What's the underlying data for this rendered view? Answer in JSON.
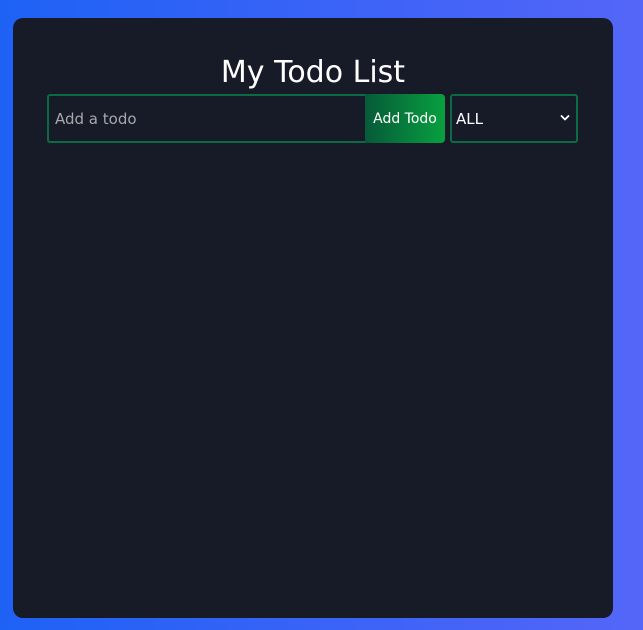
{
  "app": {
    "title": "My Todo List"
  },
  "form": {
    "input_placeholder": "Add a todo",
    "input_value": "",
    "add_button_label": "Add Todo"
  },
  "filter": {
    "selected": "ALL"
  },
  "todos": [],
  "colors": {
    "background_gradient_start": "#1e62f5",
    "background_gradient_end": "#5466f8",
    "panel": "#171b27",
    "border_accent": "#0c6a45",
    "button_gradient_start": "#065a38",
    "button_gradient_end": "#08a03f"
  },
  "icons": {
    "filter_dropdown": "chevron-down-icon"
  }
}
